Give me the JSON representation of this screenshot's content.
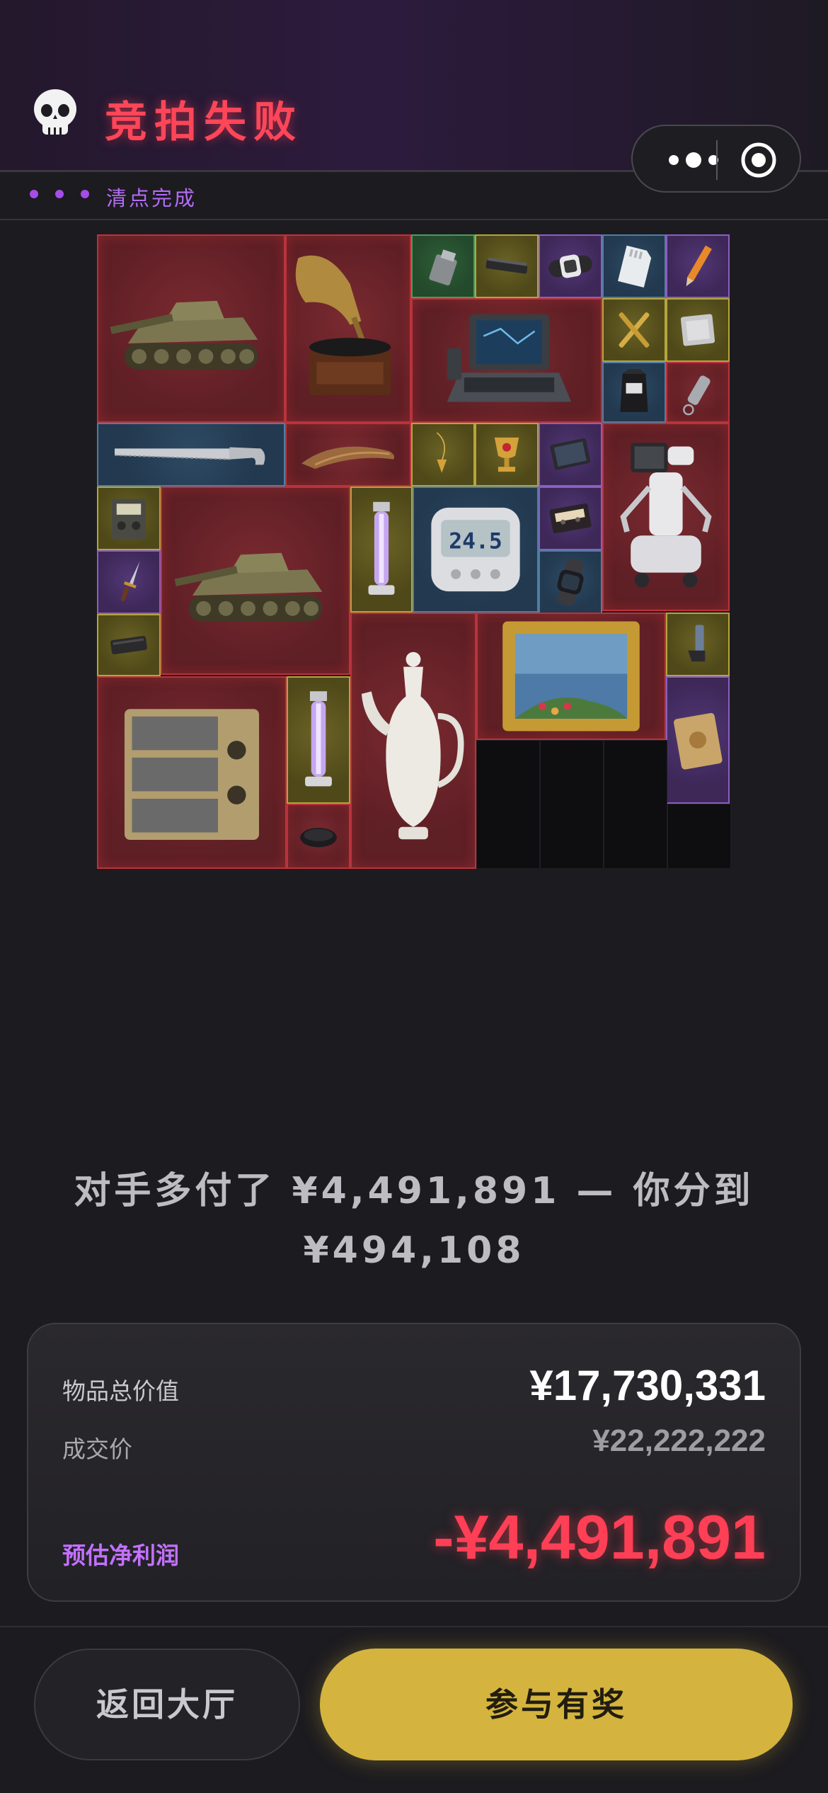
{
  "header": {
    "title": "竞拍失败",
    "skull_icon": "skull-icon",
    "status_text": "清点完成"
  },
  "capsule": {
    "more_icon": "more-dots-icon",
    "close_icon": "target-circle-icon"
  },
  "grid_items": [
    {
      "name": "tank",
      "rarity": "red"
    },
    {
      "name": "gramophone",
      "rarity": "red"
    },
    {
      "name": "lighter",
      "rarity": "green"
    },
    {
      "name": "harmonica",
      "rarity": "yellow"
    },
    {
      "name": "smartwatch",
      "rarity": "purple"
    },
    {
      "name": "sd-card",
      "rarity": "blue"
    },
    {
      "name": "pencil",
      "rarity": "purple"
    },
    {
      "name": "rugged-laptop",
      "rarity": "red"
    },
    {
      "name": "crossed-pens",
      "rarity": "yellow"
    },
    {
      "name": "cpu-chip",
      "rarity": "yellow"
    },
    {
      "name": "coffee-bag",
      "rarity": "blue"
    },
    {
      "name": "flashlight-keychain",
      "rarity": "red"
    },
    {
      "name": "saw",
      "rarity": "blue"
    },
    {
      "name": "horn",
      "rarity": "red"
    },
    {
      "name": "pendulum",
      "rarity": "yellow"
    },
    {
      "name": "trophy-cup",
      "rarity": "yellow"
    },
    {
      "name": "tablet",
      "rarity": "purple"
    },
    {
      "name": "service-robot",
      "rarity": "red"
    },
    {
      "name": "radio-meter",
      "rarity": "yellow"
    },
    {
      "name": "tank",
      "rarity": "red"
    },
    {
      "name": "uv-lamp-tube",
      "rarity": "yellow"
    },
    {
      "name": "digital-thermometer",
      "rarity": "blue"
    },
    {
      "name": "cassette-tape",
      "rarity": "purple"
    },
    {
      "name": "dagger",
      "rarity": "purple"
    },
    {
      "name": "watch",
      "rarity": "blue"
    },
    {
      "name": "phone-case",
      "rarity": "yellow"
    },
    {
      "name": "oil-painting",
      "rarity": "red"
    },
    {
      "name": "inhaler",
      "rarity": "yellow"
    },
    {
      "name": "server-rack",
      "rarity": "red"
    },
    {
      "name": "uv-lamp-tube",
      "rarity": "yellow"
    },
    {
      "name": "porcelain-ewer",
      "rarity": "red"
    },
    {
      "name": "package-bag",
      "rarity": "purple"
    },
    {
      "name": "wristband",
      "rarity": "red"
    }
  ],
  "thermometer_reading": "24.5",
  "message": {
    "line1": "对手多付了 ¥4,491,891 — 你分到",
    "line2": "¥494,108"
  },
  "summary": {
    "total_label": "物品总价值",
    "total_value": "¥17,730,331",
    "deal_label": "成交价",
    "deal_value": "¥22,222,222",
    "profit_label": "预估净利润",
    "profit_value": "-¥4,491,891"
  },
  "buttons": {
    "back": "返回大厅",
    "join": "参与有奖"
  },
  "colors": {
    "title": "#ff4659",
    "accent_purple": "#b36cf5",
    "profit": "#ff3f55",
    "join_button": "#d4b43e"
  }
}
